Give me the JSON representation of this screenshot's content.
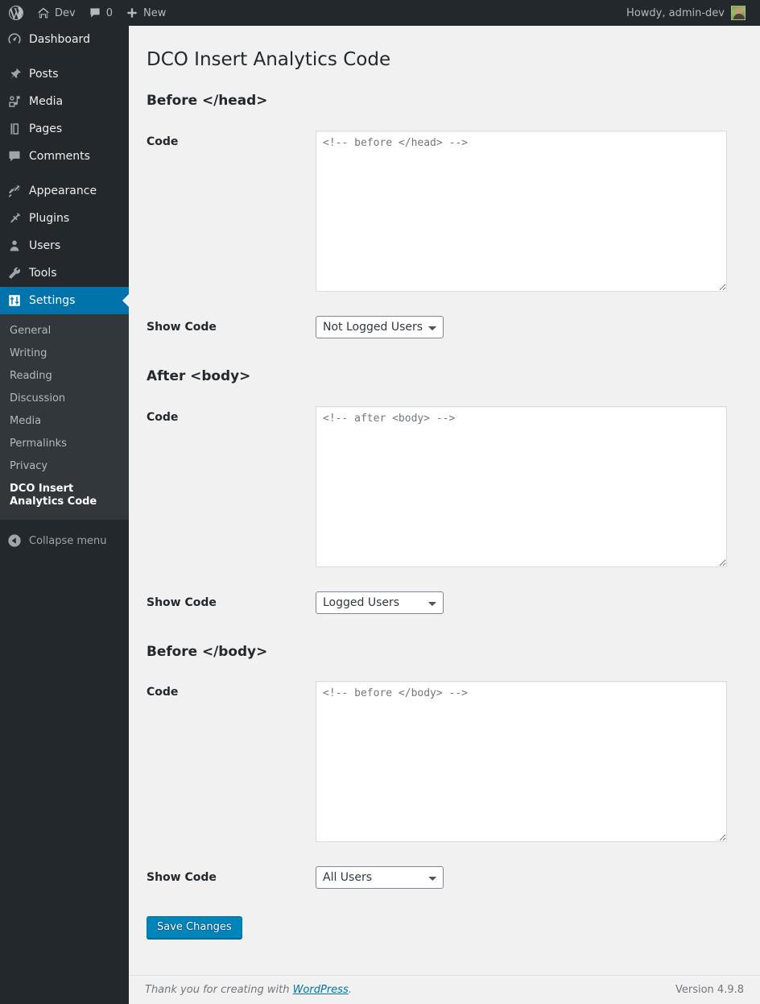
{
  "adminbar": {
    "logo_icon": "wordpress-logo-icon",
    "site_name": "Dev",
    "site_icon": "home-icon",
    "comments_icon": "comment-bubble-icon",
    "comments_count": "0",
    "new_icon": "plus-icon",
    "new_label": "New",
    "howdy": "Howdy, admin-dev",
    "avatar_icon": "user-avatar"
  },
  "sidebar": {
    "items": [
      {
        "label": "Dashboard",
        "icon": "dashboard-icon",
        "sep_after": true
      },
      {
        "label": "Posts",
        "icon": "pin-icon",
        "sep_after": false
      },
      {
        "label": "Media",
        "icon": "media-icon",
        "sep_after": false
      },
      {
        "label": "Pages",
        "icon": "page-icon",
        "sep_after": false
      },
      {
        "label": "Comments",
        "icon": "comment-bubble-icon",
        "sep_after": true
      },
      {
        "label": "Appearance",
        "icon": "paintbrush-icon",
        "sep_after": false
      },
      {
        "label": "Plugins",
        "icon": "plug-icon",
        "sep_after": false
      },
      {
        "label": "Users",
        "icon": "user-icon",
        "sep_after": false
      },
      {
        "label": "Tools",
        "icon": "wrench-icon",
        "sep_after": false
      },
      {
        "label": "Settings",
        "icon": "settings-sliders-icon",
        "sep_after": false,
        "current": true
      }
    ],
    "submenu": [
      {
        "label": "General"
      },
      {
        "label": "Writing"
      },
      {
        "label": "Reading"
      },
      {
        "label": "Discussion"
      },
      {
        "label": "Media"
      },
      {
        "label": "Permalinks"
      },
      {
        "label": "Privacy"
      },
      {
        "label": "DCO Insert Analytics Code",
        "current": true
      }
    ],
    "collapse_label": "Collapse menu",
    "collapse_icon": "arrow-left-circle-icon",
    "active_color": "#0073aa"
  },
  "main": {
    "page_title": "DCO Insert Analytics Code",
    "sections": [
      {
        "heading": "Before </head>",
        "code_label": "Code",
        "code_value": "",
        "code_placeholder": "<!-- before </head> -->",
        "show_label": "Show Code",
        "show_value": "Not Logged Users",
        "show_options": [
          "All Users",
          "Logged Users",
          "Not Logged Users"
        ]
      },
      {
        "heading": "After <body>",
        "code_label": "Code",
        "code_value": "",
        "code_placeholder": "<!-- after <body> -->",
        "show_label": "Show Code",
        "show_value": "Logged Users",
        "show_options": [
          "All Users",
          "Logged Users",
          "Not Logged Users"
        ]
      },
      {
        "heading": "Before </body>",
        "code_label": "Code",
        "code_value": "",
        "code_placeholder": "<!-- before </body> -->",
        "show_label": "Show Code",
        "show_value": "All Users",
        "show_options": [
          "All Users",
          "Logged Users",
          "Not Logged Users"
        ]
      }
    ],
    "save_label": "Save Changes",
    "save_color": "#0085ba"
  },
  "footer": {
    "thanks_prefix": "Thank you for creating with ",
    "wordpress_link": "WordPress",
    "thanks_suffix": ".",
    "version": "Version 4.9.8"
  }
}
